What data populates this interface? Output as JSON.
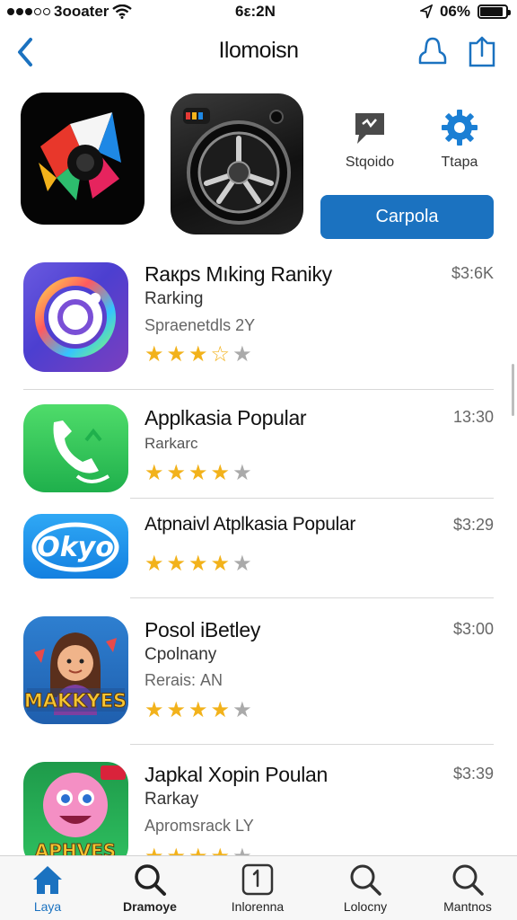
{
  "status_bar": {
    "carrier": "3ooater",
    "time": "6ε:2Ν",
    "battery": "06%",
    "battery_level": 0.9
  },
  "nav": {
    "title": "Ilomoisn",
    "back_icon": "chevron-left-icon",
    "action_icons": [
      "user-outline-icon",
      "share-icon"
    ]
  },
  "featured": {
    "quick_actions": [
      {
        "label": "Stqoido",
        "icon": "chat-bubble-icon"
      },
      {
        "label": "Ttapa",
        "icon": "gear-icon"
      }
    ],
    "primary_button": "Carpola"
  },
  "apps": [
    {
      "name": "Raкps Mıking Raniky",
      "subtitle": "Rarking",
      "meta": "Spraenetdls 2Y",
      "price": "$3:6K",
      "rating": 3.5,
      "icon": "camera-lens-icon"
    },
    {
      "name": "Applkasia Popular",
      "subtitle": "Rarkarc",
      "meta": "",
      "price": "13:30",
      "rating": 4,
      "icon": "phone-chat-icon"
    },
    {
      "name": "Atpnaivl Atplkasia Popular",
      "subtitle": "",
      "meta": "",
      "price": "$3:29",
      "rating": 4,
      "icon": "cloud-logo-icon"
    },
    {
      "name": "Posol iBetley",
      "subtitle": "Cpolnany",
      "meta": "Rerais: ΑΝ",
      "price": "$3:00",
      "rating": 4,
      "icon": "character-game-icon",
      "icon_text": "MAKKYES"
    },
    {
      "name": "Japkal Xopin Poulan",
      "subtitle": "Rarkay",
      "meta": "Apromsrack LY",
      "price": "$3:39",
      "rating": 4,
      "icon": "pink-monster-icon",
      "icon_text": "APHVES"
    }
  ],
  "tabs": [
    {
      "label": "Laya",
      "icon": "home-icon",
      "active": true
    },
    {
      "label": "Dramoye",
      "icon": "search-icon",
      "active": false
    },
    {
      "label": "Inlorenna",
      "icon": "update-box-icon",
      "active": false
    },
    {
      "label": "Lolocny",
      "icon": "search-icon",
      "active": false
    },
    {
      "label": "Mantnos",
      "icon": "search-icon",
      "active": false
    }
  ],
  "colors": {
    "accent": "#1b72c0",
    "star": "#f2b21b",
    "star_off": "#aaaaaa"
  }
}
